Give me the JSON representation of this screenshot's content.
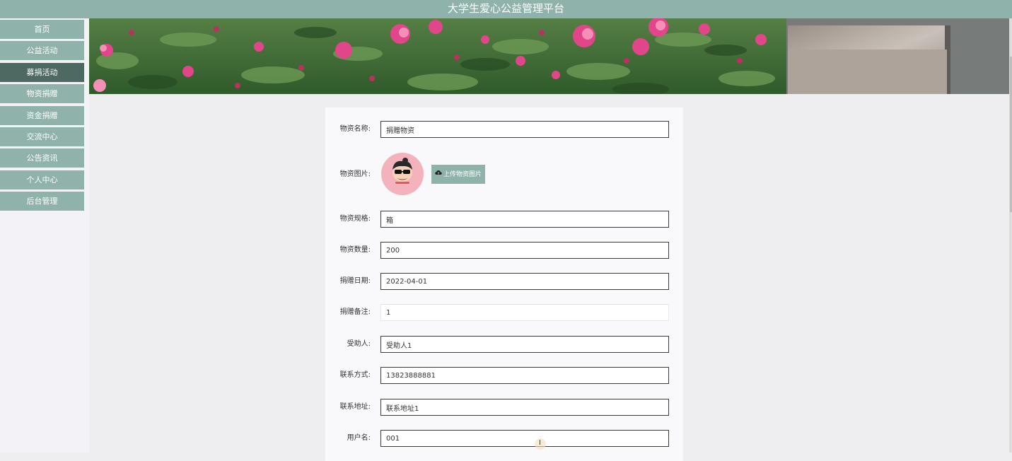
{
  "header": {
    "title": "大学生爱心公益管理平台"
  },
  "sidebar": {
    "items": [
      {
        "label": "首页"
      },
      {
        "label": "公益活动"
      },
      {
        "label": "募捐活动"
      },
      {
        "label": "物资捐赠"
      },
      {
        "label": "资金捐赠"
      },
      {
        "label": "交流中心"
      },
      {
        "label": "公告资讯"
      },
      {
        "label": "个人中心"
      },
      {
        "label": "后台管理"
      }
    ],
    "active_item": "募捐活动"
  },
  "form": {
    "name": {
      "label": "物资名称:",
      "value": "捐赠物资"
    },
    "image": {
      "label": "物资图片:",
      "upload_label": "上传物资图片",
      "upload_icon": "cloud-upload-icon"
    },
    "spec": {
      "label": "物资规格:",
      "value": "箱"
    },
    "quantity": {
      "label": "物资数量:",
      "value": "200"
    },
    "date": {
      "label": "捐赠日期:",
      "value": "2022-04-01"
    },
    "remark": {
      "label": "捐赠备注:",
      "value": "1"
    },
    "recipient": {
      "label": "受助人:",
      "value": "受助人1"
    },
    "contact": {
      "label": "联系方式:",
      "value": "13823888881"
    },
    "address": {
      "label": "联系地址:",
      "value": "联系地址1"
    },
    "username": {
      "label": "用户名:",
      "value": "001"
    }
  },
  "colors": {
    "accent": "#8fb2aa",
    "active_nav": "#4e6961",
    "page_bg": "#eeeef0"
  }
}
